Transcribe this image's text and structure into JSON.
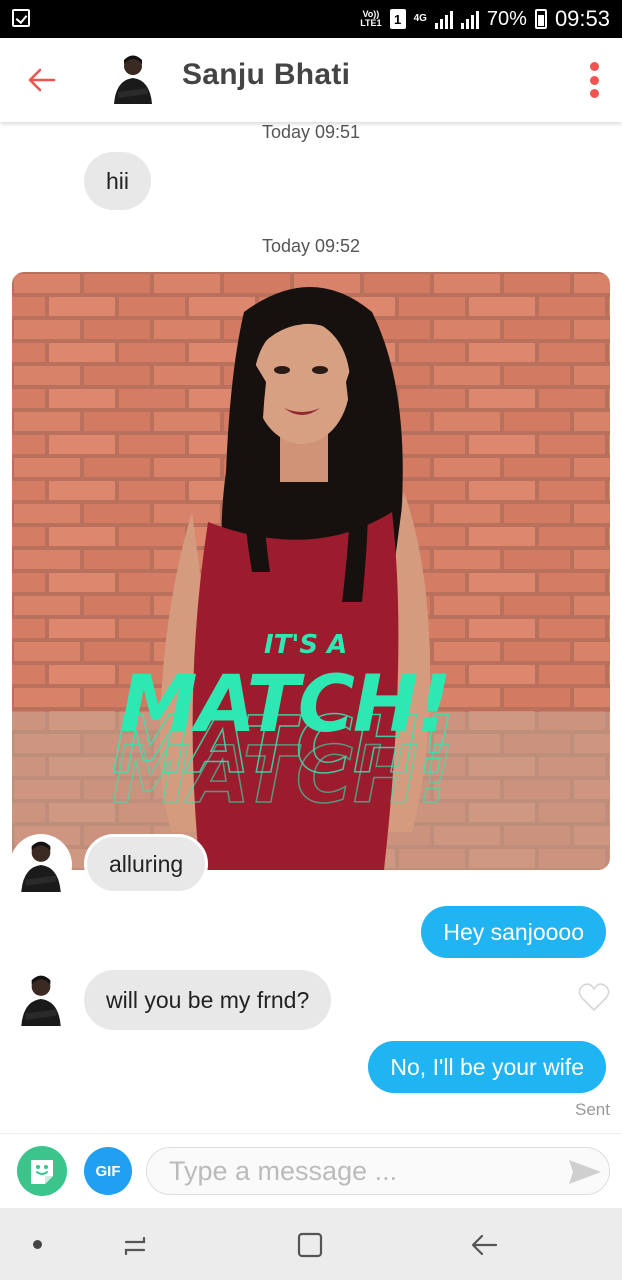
{
  "status_bar": {
    "volte": "Vo)) LTE1",
    "sim": "1",
    "network": "4G",
    "battery": "70%",
    "time": "09:53"
  },
  "header": {
    "contact_name": "Sanju Bhati",
    "back_icon": "arrow-left-icon",
    "menu_icon": "more-vertical-icon",
    "accent_color": "#f0544f"
  },
  "conversation": {
    "timestamp_1": "Today 09:51",
    "msg_hii": "hii",
    "timestamp_2": "Today 09:52",
    "match_card": {
      "line1": "IT'S A",
      "line2": "MATCH!"
    },
    "msg_alluring": "alluring",
    "msg_hey": "Hey sanjoooo",
    "msg_frnd": "will you be my frnd?",
    "msg_wife": "No, I'll be your wife",
    "sent_status": "Sent"
  },
  "composer": {
    "gif_label": "GIF",
    "placeholder": "Type a message ...",
    "sticker_icon": "sticker-icon",
    "send_icon": "send-icon"
  },
  "colors": {
    "outgoing_bubble": "#21b4f2",
    "incoming_bubble": "#e8e8e8",
    "match_text": "#2ee8b4",
    "sticker_button": "#3cc48d",
    "gif_button": "#21a0f2"
  }
}
